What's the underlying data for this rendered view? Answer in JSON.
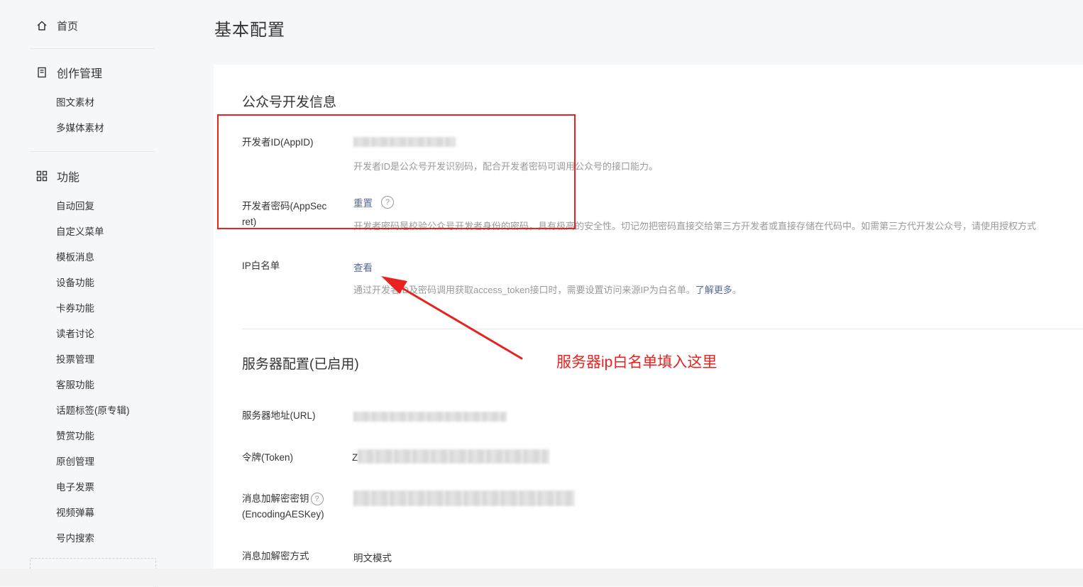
{
  "sidebar": {
    "home": "首页",
    "groups": [
      {
        "title": "创作管理",
        "icon": "document-icon",
        "items": [
          "图文素材",
          "多媒体素材"
        ]
      },
      {
        "title": "功能",
        "icon": "grid-icon",
        "items": [
          "自动回复",
          "自定义菜单",
          "模板消息",
          "设备功能",
          "卡券功能",
          "读者讨论",
          "投票管理",
          "客服功能",
          "话题标签(原专辑)",
          "赞赏功能",
          "原创管理",
          "电子发票",
          "视频弹幕",
          "号内搜索"
        ]
      }
    ]
  },
  "page": {
    "title": "基本配置"
  },
  "dev_info": {
    "title": "公众号开发信息",
    "appid": {
      "label": "开发者ID(AppID)",
      "desc": "开发者ID是公众号开发识别码，配合开发者密码可调用公众号的接口能力。"
    },
    "secret": {
      "label_line1": "开发者密码(AppSec",
      "label_line2": "ret)",
      "action": "重置",
      "desc": "开发者密码是校验公众号开发者身份的密码，具有极高的安全性。切记勿把密码直接交给第三方开发者或直接存储在代码中。如需第三方代开发公众号，请使用授权方式"
    },
    "ip_whitelist": {
      "label": "IP白名单",
      "action": "查看",
      "desc_before": "通过开发者ID及密码调用获取access_token接口时，需要设置访问来源IP为白名单。",
      "desc_link": "了解更多",
      "desc_after": "。"
    }
  },
  "server_config": {
    "title": "服务器配置(已启用)",
    "url_label": "服务器地址(URL)",
    "token_label": "令牌(Token)",
    "token_visible_char": "Z",
    "aes_label_line1": "消息加解密密钥",
    "aes_label_line2": "(EncodingAESKey)",
    "mode_label": "消息加解密方式",
    "mode_value": "明文模式"
  },
  "annotation": {
    "text": "服务器ip白名单填入这里",
    "color": "#e8221f"
  },
  "colors": {
    "link": "#576b95",
    "muted": "#9a9a9a",
    "text": "#353535",
    "background": "#f6f7f9"
  }
}
